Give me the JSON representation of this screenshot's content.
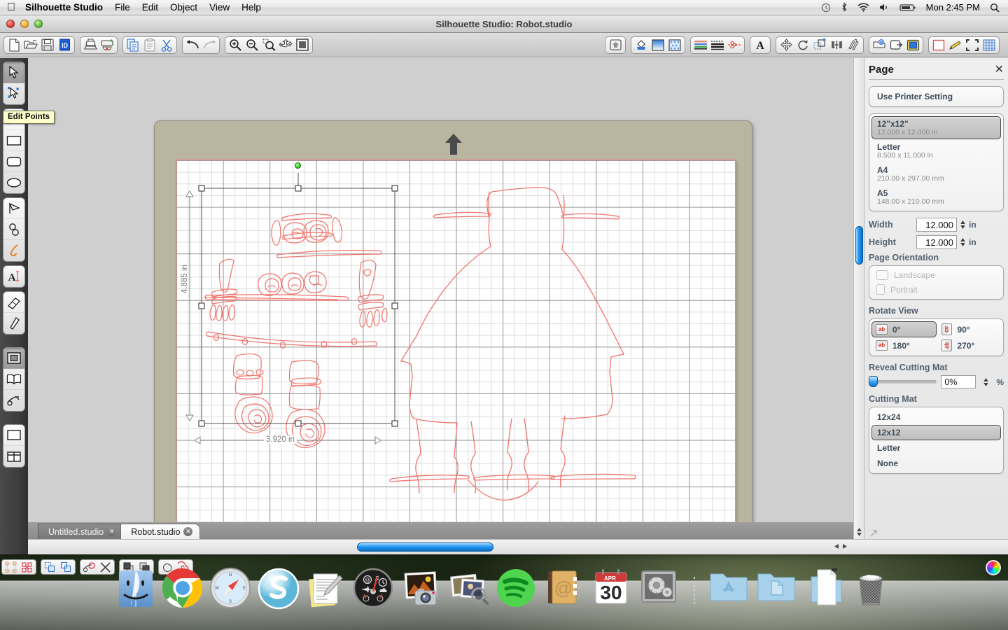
{
  "menubar": {
    "apple_icon": "apple-icon",
    "app_name": "Silhouette Studio",
    "items": [
      "File",
      "Edit",
      "Object",
      "View",
      "Help"
    ],
    "status_icons": [
      "time-machine-icon",
      "bluetooth-icon",
      "wifi-icon",
      "volume-icon",
      "battery-icon"
    ],
    "clock": "Mon 2:45 PM",
    "spotlight_icon": "search-icon"
  },
  "window": {
    "title": "Silhouette Studio: Robot.studio",
    "traffic_lights": [
      "close-button",
      "minimize-button",
      "zoom-button"
    ]
  },
  "toolbar": {
    "groups": [
      {
        "name": "file-group",
        "buttons": [
          {
            "name": "new-document-button",
            "icon": "page-icon"
          },
          {
            "name": "open-document-button",
            "icon": "folder-open-icon"
          },
          {
            "name": "save-document-button",
            "icon": "floppy-disk-icon"
          },
          {
            "name": "save-library-button",
            "icon": "blue-library-icon"
          }
        ]
      },
      {
        "name": "print-group",
        "buttons": [
          {
            "name": "print-button",
            "icon": "printer-icon"
          },
          {
            "name": "send-to-silhouette-button",
            "icon": "cutter-icon"
          }
        ]
      },
      {
        "name": "clipboard-group",
        "buttons": [
          {
            "name": "copy-button",
            "icon": "copy-icon"
          },
          {
            "name": "paste-button",
            "icon": "clipboard-icon"
          },
          {
            "name": "cut-button",
            "icon": "scissors-icon"
          }
        ]
      },
      {
        "name": "history-group",
        "buttons": [
          {
            "name": "undo-button",
            "icon": "undo-arrow-icon"
          },
          {
            "name": "redo-button",
            "icon": "redo-arrow-icon"
          }
        ]
      },
      {
        "name": "zoom-group",
        "buttons": [
          {
            "name": "zoom-in-button",
            "icon": "magnifier-plus-icon"
          },
          {
            "name": "zoom-out-button",
            "icon": "magnifier-minus-icon"
          },
          {
            "name": "zoom-selection-button",
            "icon": "magnifier-marquee-icon"
          },
          {
            "name": "pan-button",
            "icon": "hand-icon"
          },
          {
            "name": "fit-to-page-button",
            "icon": "fit-page-icon"
          }
        ]
      },
      {
        "name": "panels-group-1",
        "buttons": [
          {
            "name": "open-library-button",
            "icon": "house-icon"
          }
        ]
      },
      {
        "name": "fill-group",
        "buttons": [
          {
            "name": "fill-color-button",
            "icon": "paint-bucket-icon"
          },
          {
            "name": "gradient-fill-button",
            "icon": "gradient-square-icon"
          },
          {
            "name": "pattern-fill-button",
            "icon": "pattern-square-icon"
          }
        ]
      },
      {
        "name": "line-group",
        "buttons": [
          {
            "name": "line-color-button",
            "icon": "color-lines-icon"
          },
          {
            "name": "line-style-button",
            "icon": "line-style-icon"
          },
          {
            "name": "cut-style-button",
            "icon": "cut-style-icon"
          }
        ]
      },
      {
        "name": "text-group",
        "buttons": [
          {
            "name": "text-style-button",
            "icon": "letter-a-icon"
          }
        ]
      },
      {
        "name": "transform-group",
        "buttons": [
          {
            "name": "move-button",
            "icon": "four-arrows-icon"
          },
          {
            "name": "rotate-button",
            "icon": "rotate-icon"
          },
          {
            "name": "scale-button",
            "icon": "scale-icon"
          },
          {
            "name": "align-button",
            "icon": "align-icon"
          },
          {
            "name": "replicate-button",
            "icon": "replicate-icon"
          }
        ]
      },
      {
        "name": "modify-group",
        "buttons": [
          {
            "name": "modify-button",
            "icon": "modify-shapes-icon"
          },
          {
            "name": "offset-button",
            "icon": "offset-icon"
          },
          {
            "name": "trace-button",
            "icon": "trace-icon"
          }
        ]
      },
      {
        "name": "page-group",
        "buttons": [
          {
            "name": "page-setup-button",
            "icon": "page-frame-icon"
          },
          {
            "name": "sketch-pens-button",
            "icon": "pencil-icon"
          },
          {
            "name": "registration-marks-button",
            "icon": "corner-marks-icon"
          },
          {
            "name": "grid-settings-button",
            "icon": "grid-icon"
          }
        ]
      }
    ]
  },
  "tools": {
    "tooltip": "Edit Points",
    "groups": [
      {
        "name": "select-group",
        "tools": [
          {
            "name": "select-tool",
            "icon": "arrow-cursor-icon",
            "selected": true
          },
          {
            "name": "edit-points-tool",
            "icon": "edit-points-icon",
            "selected": false
          }
        ]
      },
      {
        "name": "shape-group",
        "tools": [
          {
            "name": "line-tool",
            "icon": "line-icon",
            "selected": false
          },
          {
            "name": "rectangle-tool",
            "icon": "rectangle-icon",
            "selected": false
          },
          {
            "name": "rounded-rectangle-tool",
            "icon": "rounded-rect-icon",
            "selected": false
          },
          {
            "name": "ellipse-tool",
            "icon": "ellipse-icon",
            "selected": false
          }
        ]
      },
      {
        "name": "draw-group",
        "tools": [
          {
            "name": "polygon-tool",
            "icon": "polygon-icon",
            "selected": false
          },
          {
            "name": "curve-tool",
            "icon": "curve-icon",
            "selected": false
          },
          {
            "name": "freehand-tool",
            "icon": "freehand-pen-icon",
            "selected": false
          }
        ]
      },
      {
        "name": "text-group",
        "tools": [
          {
            "name": "text-tool",
            "icon": "text-cursor-icon",
            "selected": false
          }
        ]
      },
      {
        "name": "erase-group",
        "tools": [
          {
            "name": "eraser-tool",
            "icon": "eraser-icon",
            "selected": false
          },
          {
            "name": "knife-tool",
            "icon": "knife-icon",
            "selected": false
          }
        ]
      },
      {
        "name": "panel-group",
        "tools": [
          {
            "name": "page-panel-tool",
            "icon": "page-panel-icon",
            "selected": true
          },
          {
            "name": "library-panel-tool",
            "icon": "open-book-icon",
            "selected": false
          },
          {
            "name": "cut-settings-tool",
            "icon": "cut-settings-icon",
            "selected": false
          }
        ]
      },
      {
        "name": "view-group",
        "tools": [
          {
            "name": "single-view-tool",
            "icon": "single-pane-icon",
            "selected": false
          },
          {
            "name": "split-view-tool",
            "icon": "split-pane-icon",
            "selected": false
          }
        ]
      }
    ]
  },
  "align_toolbar": {
    "groups": [
      [
        {
          "name": "group-objects-button",
          "icon": "group-icon"
        },
        {
          "name": "ungroup-objects-button",
          "icon": "ungroup-icon"
        }
      ],
      [
        {
          "name": "make-compound-path-button",
          "icon": "compound-path-icon"
        },
        {
          "name": "release-compound-path-button",
          "icon": "release-path-icon"
        }
      ],
      [
        {
          "name": "weld-button",
          "icon": "weld-icon"
        },
        {
          "name": "detach-lines-button",
          "icon": "detach-icon"
        }
      ],
      [
        {
          "name": "bring-to-front-button",
          "icon": "front-icon"
        },
        {
          "name": "send-to-back-button",
          "icon": "back-icon"
        }
      ],
      [
        {
          "name": "merge-button",
          "icon": "merge-icon"
        },
        {
          "name": "spiral-button",
          "icon": "spiral-icon"
        }
      ]
    ]
  },
  "canvas": {
    "mat_arrow_icon": "mat-load-arrow-icon",
    "origin_marker": "origin-dot",
    "selection": {
      "width_label": "3.920 in",
      "height_label": "4.885 in",
      "handles": 8
    }
  },
  "tabs": [
    {
      "label": "Untitled.studio",
      "active": false,
      "close_icon": "close-icon"
    },
    {
      "label": "Robot.studio",
      "active": true,
      "close_icon": "close-icon"
    }
  ],
  "panel": {
    "title": "Page",
    "close_icon": "close-icon",
    "printer_setting_label": "Use Printer Setting",
    "page_sizes": [
      {
        "name": "12\"x12\"",
        "dims": "12.000 x 12.000 in",
        "selected": true
      },
      {
        "name": "Letter",
        "dims": "8.500 x 11.000 in",
        "selected": false
      },
      {
        "name": "A4",
        "dims": "210.00 x 297.00 mm",
        "selected": false
      },
      {
        "name": "A5",
        "dims": "148.00 x 210.00 mm",
        "selected": false
      }
    ],
    "width_label": "Width",
    "width_value": "12.000",
    "height_label": "Height",
    "height_value": "12.000",
    "unit": "in",
    "orientation_title": "Page Orientation",
    "orientation_options": [
      {
        "label": "Landscape",
        "selected": false
      },
      {
        "label": "Portrait",
        "selected": false
      }
    ],
    "rotate_title": "Rotate View",
    "rotate_options": [
      {
        "label": "0°",
        "glyph": "ab",
        "selected": true
      },
      {
        "label": "90°",
        "glyph": "ab",
        "selected": false
      },
      {
        "label": "180°",
        "glyph": "qe",
        "selected": false
      },
      {
        "label": "270°",
        "glyph": "ab",
        "selected": false
      }
    ],
    "reveal_title": "Reveal Cutting Mat",
    "reveal_value": "0%",
    "reveal_unit": "%",
    "cutting_mat_title": "Cutting Mat",
    "cutting_mats": [
      {
        "label": "12x24",
        "selected": false
      },
      {
        "label": "12x12",
        "selected": true
      },
      {
        "label": "Letter",
        "selected": false
      },
      {
        "label": "None",
        "selected": false
      }
    ]
  },
  "dock": {
    "items": [
      {
        "name": "finder-icon",
        "label": "Finder"
      },
      {
        "name": "chrome-icon",
        "label": "Google Chrome"
      },
      {
        "name": "safari-icon",
        "label": "Safari"
      },
      {
        "name": "silhouette-studio-icon",
        "label": "Silhouette Studio"
      },
      {
        "name": "notes-icon",
        "label": "Notes"
      },
      {
        "name": "dashboard-icon",
        "label": "Dashboard"
      },
      {
        "name": "iphoto-icon",
        "label": "iPhoto"
      },
      {
        "name": "preview-icon",
        "label": "Preview"
      },
      {
        "name": "spotify-icon",
        "label": "Spotify"
      },
      {
        "name": "contacts-icon",
        "label": "Contacts"
      },
      {
        "name": "calendar-icon",
        "label": "Calendar",
        "month": "APR",
        "day": "30"
      },
      {
        "name": "system-preferences-icon",
        "label": "System Preferences"
      },
      {
        "name": "applications-folder-icon",
        "label": "Applications"
      },
      {
        "name": "documents-folder-icon",
        "label": "Documents"
      },
      {
        "name": "downloads-stack-icon",
        "label": "Downloads"
      },
      {
        "name": "trash-icon",
        "label": "Trash"
      }
    ]
  },
  "colors": {
    "cut_line": "#f0746c",
    "mat": "#b9b5a0",
    "accent_blue": "#2498f2",
    "panel_text": "#46515c"
  }
}
